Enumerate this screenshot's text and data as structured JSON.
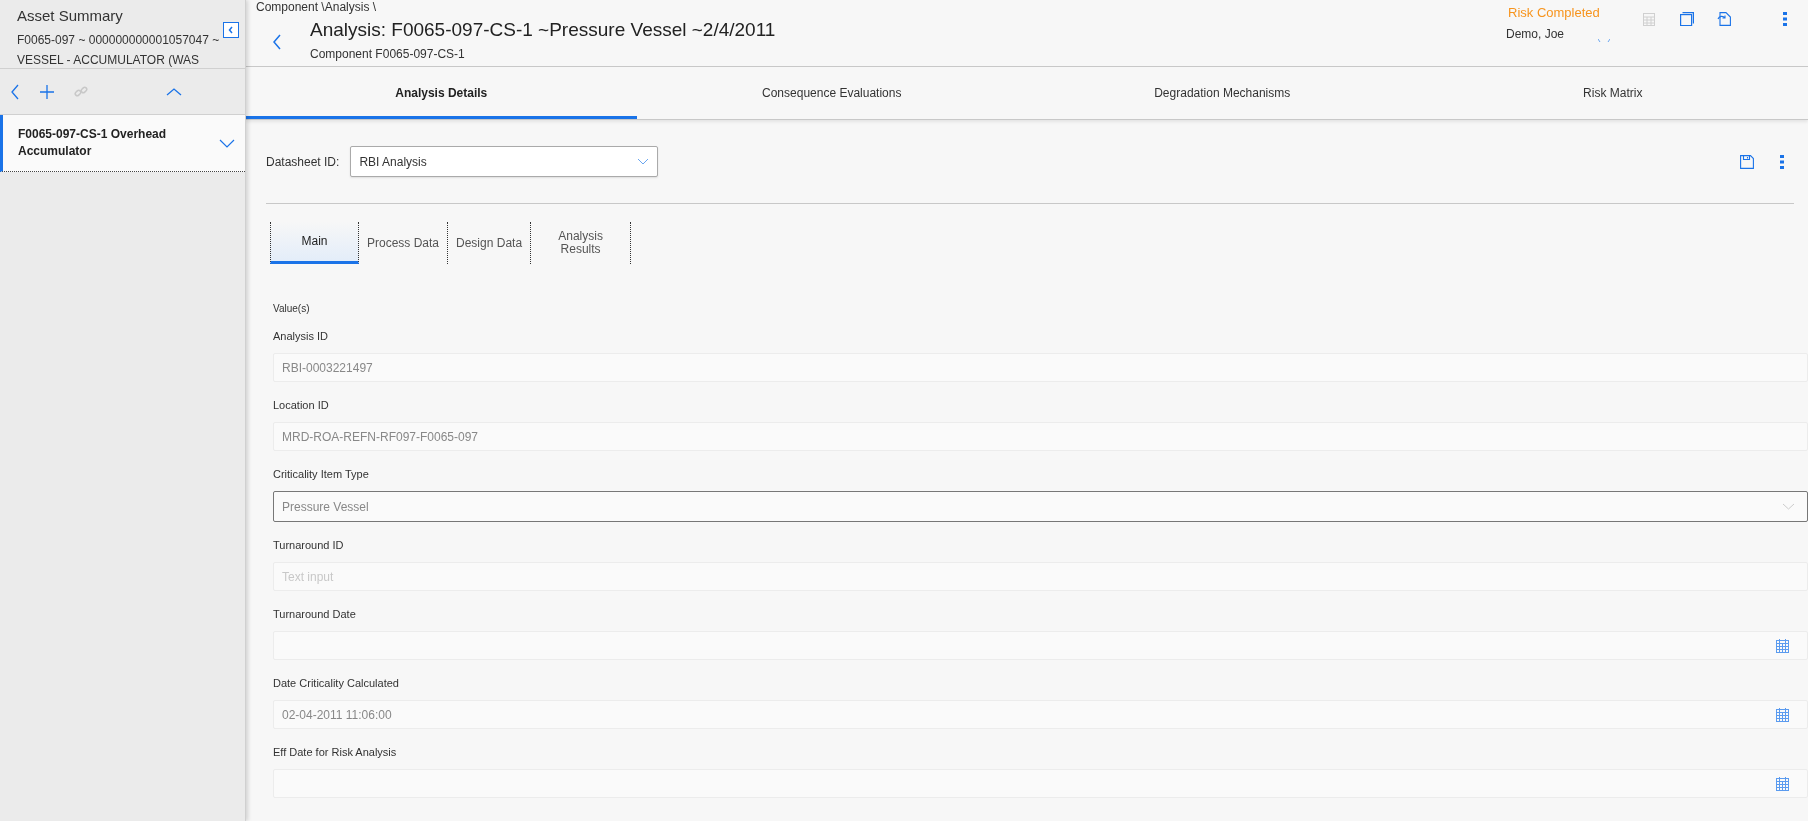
{
  "sidebar": {
    "title": "Asset Summary",
    "subtitle_lines": [
      "F0065-097 ~ 000000000001057047 ~",
      "VESSEL - ACCUMULATOR (WAS"
    ],
    "items": [
      {
        "label": "F0065-097-CS-1 Overhead Accumulator",
        "selected": true
      }
    ]
  },
  "header": {
    "breadcrumb": "Component \\Analysis \\",
    "title": "Analysis: F0065-097-CS-1 ~Pressure Vessel ~2/4/2011",
    "subtitle": "Component F0065-097-CS-1",
    "status": "Risk Completed",
    "user": "Demo, Joe"
  },
  "tabs": [
    {
      "label": "Analysis Details",
      "selected": true
    },
    {
      "label": "Consequence Evaluations",
      "selected": false
    },
    {
      "label": "Degradation Mechanisms",
      "selected": false
    },
    {
      "label": "Risk Matrix",
      "selected": false
    }
  ],
  "datasheet": {
    "label": "Datasheet ID:",
    "value": "RBI Analysis"
  },
  "subtabs": [
    {
      "label": "Main",
      "selected": true
    },
    {
      "label": "Process Data",
      "selected": false
    },
    {
      "label": "Design Data",
      "selected": false
    },
    {
      "label": "Analysis Results",
      "selected": false
    }
  ],
  "section_label": "Value(s)",
  "fields": [
    {
      "label": "Analysis ID",
      "kind": "text",
      "value": "RBI-0003221497"
    },
    {
      "label": "Location ID",
      "kind": "text",
      "value": "MRD-ROA-REFN-RF097-F0065-097"
    },
    {
      "label": "Criticality Item Type",
      "kind": "select",
      "value": "Pressure Vessel"
    },
    {
      "label": "Turnaround ID",
      "kind": "text",
      "placeholder": "Text input"
    },
    {
      "label": "Turnaround Date",
      "kind": "date"
    },
    {
      "label": "Date Criticality Calculated",
      "kind": "date",
      "value": "02-04-2011 11:06:00"
    },
    {
      "label": "Eff Date for Risk Analysis",
      "kind": "date"
    }
  ]
}
